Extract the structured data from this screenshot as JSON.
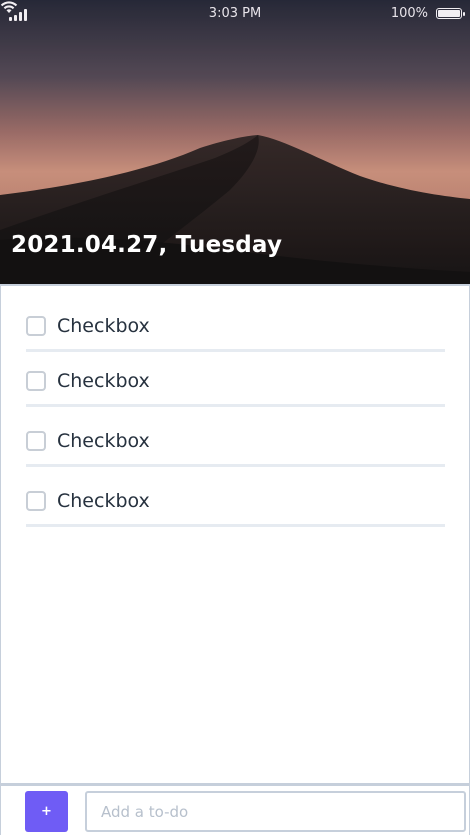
{
  "status_bar": {
    "time": "3:03 PM",
    "battery": "100%"
  },
  "header": {
    "date": "2021.04.27, Tuesday"
  },
  "todos": [
    {
      "label": "Checkbox",
      "checked": false
    },
    {
      "label": "Checkbox",
      "checked": false
    },
    {
      "label": "Checkbox",
      "checked": false
    },
    {
      "label": "Checkbox",
      "checked": false
    }
  ],
  "composer": {
    "add_label": "+",
    "placeholder": "Add a to-do"
  },
  "colors": {
    "accent": "#6f5cf5",
    "border": "#c6cfdb",
    "text": "#27323f"
  },
  "icons": {
    "signal": "signal-icon",
    "wifi": "wifi-icon",
    "battery": "battery-icon"
  }
}
